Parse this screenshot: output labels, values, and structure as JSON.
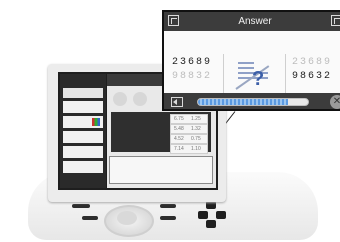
{
  "callout": {
    "title": "Answer",
    "left_number": "23689",
    "left_number_faded": "98832",
    "middle_question": "?",
    "right_number_faded": "23689",
    "right_number": "98632",
    "progress": 0.82,
    "icons": {
      "resize": "resize-icon",
      "maximize": "maximize-icon",
      "back": "back-arrow-icon",
      "close": "close-icon"
    }
  },
  "device_screen": {
    "rows": [
      {
        "c1": "6.75",
        "c2": "1.25"
      },
      {
        "c1": "5.48",
        "c2": "1.32"
      },
      {
        "c1": "4.52",
        "c2": "0.75"
      },
      {
        "c1": "7.14",
        "c2": "1.10"
      }
    ]
  }
}
